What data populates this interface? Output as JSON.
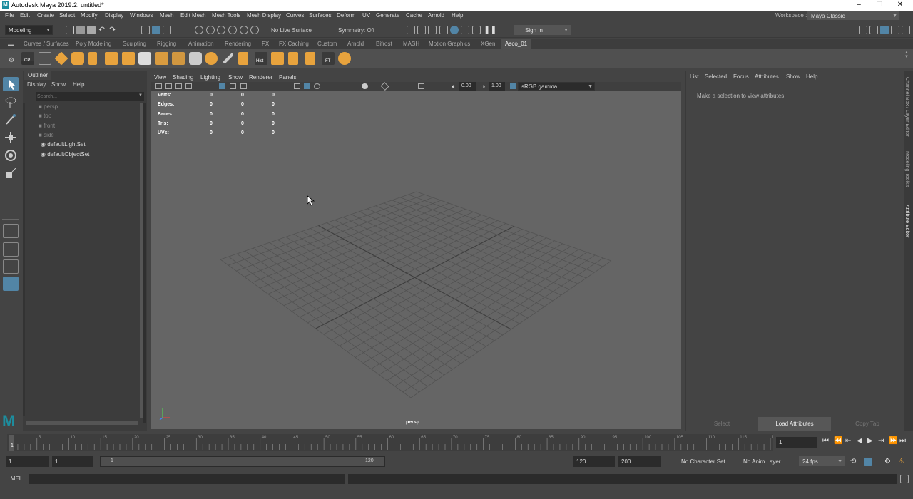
{
  "title_bar": {
    "title": "Autodesk Maya 2019.2: untitled*",
    "minimize": "–",
    "maximize": "❐",
    "close": "✕"
  },
  "menu_bar": [
    "File",
    "Edit",
    "Create",
    "Select",
    "Modify",
    "Display",
    "Windows",
    "Mesh",
    "Edit Mesh",
    "Mesh Tools",
    "Mesh Display",
    "Curves",
    "Surfaces",
    "Deform",
    "UV",
    "Generate",
    "Cache",
    "Arnold",
    "Help"
  ],
  "workspace": {
    "label": "Workspace :",
    "value": "Maya Classic"
  },
  "status_line": {
    "menu_set": "Modeling",
    "live_surface": "No Live Surface",
    "symmetry": "Symmetry: Off",
    "sign_in": "Sign In"
  },
  "shelf_tabs": [
    "Curves / Surfaces",
    "Poly Modeling",
    "Sculpting",
    "Rigging",
    "Animation",
    "Rendering",
    "FX",
    "FX Caching",
    "Custom",
    "Arnold",
    "Bifrost",
    "MASH",
    "Motion Graphics",
    "XGen",
    "Asco_01"
  ],
  "shelf_active_tab": "Asco_01",
  "shelf_labels": {
    "cp": "CP",
    "hist": "Hist",
    "ft": "FT"
  },
  "outliner": {
    "title": "Outliner",
    "menus": [
      "Display",
      "Show",
      "Help"
    ],
    "search_placeholder": "Search...",
    "items": [
      "persp",
      "top",
      "front",
      "side",
      "defaultLightSet",
      "defaultObjectSet"
    ]
  },
  "viewport": {
    "menus": [
      "View",
      "Shading",
      "Lighting",
      "Show",
      "Renderer",
      "Panels"
    ],
    "exposure": "0.00",
    "gamma": "1.00",
    "color_space": "sRGB gamma",
    "camera_label": "persp",
    "hud": {
      "rows": [
        "Verts:",
        "Edges:",
        "Faces:",
        "Tris:",
        "UVs:"
      ],
      "values": [
        [
          "0",
          "0",
          "0"
        ],
        [
          "0",
          "0",
          "0"
        ],
        [
          "0",
          "0",
          "0"
        ],
        [
          "0",
          "0",
          "0"
        ],
        [
          "0",
          "0",
          "0"
        ]
      ]
    }
  },
  "attribute_editor": {
    "menus": [
      "List",
      "Selected",
      "Focus",
      "Attributes",
      "Show",
      "Help"
    ],
    "message": "Make a selection to view attributes",
    "buttons": [
      "Select",
      "Load Attributes",
      "Copy Tab"
    ]
  },
  "side_tabs": [
    "Channel Box / Layer Editor",
    "Modeling Toolkit",
    "Attribute Editor"
  ],
  "timeline": {
    "ticks": [
      "1",
      "5",
      "10",
      "15",
      "20",
      "25",
      "30",
      "35",
      "40",
      "45",
      "50",
      "55",
      "60",
      "65",
      "70",
      "75",
      "80",
      "85",
      "90",
      "95",
      "100",
      "105",
      "110",
      "115",
      "120"
    ],
    "current_frame": "1"
  },
  "range": {
    "start": "1",
    "playback_start": "1",
    "slider_start": "1",
    "slider_end": "120",
    "playback_end": "120",
    "end": "200",
    "character_set": "No Character Set",
    "anim_layer": "No Anim Layer",
    "fps": "24 fps"
  },
  "command_line": {
    "label": "MEL"
  },
  "colors": {
    "accent": "#5285a6",
    "maya_logo": "#1d8d9e",
    "shelf_orange": "#e8a33d",
    "viewport_bg": "#656565",
    "grid_line": "#525252"
  }
}
